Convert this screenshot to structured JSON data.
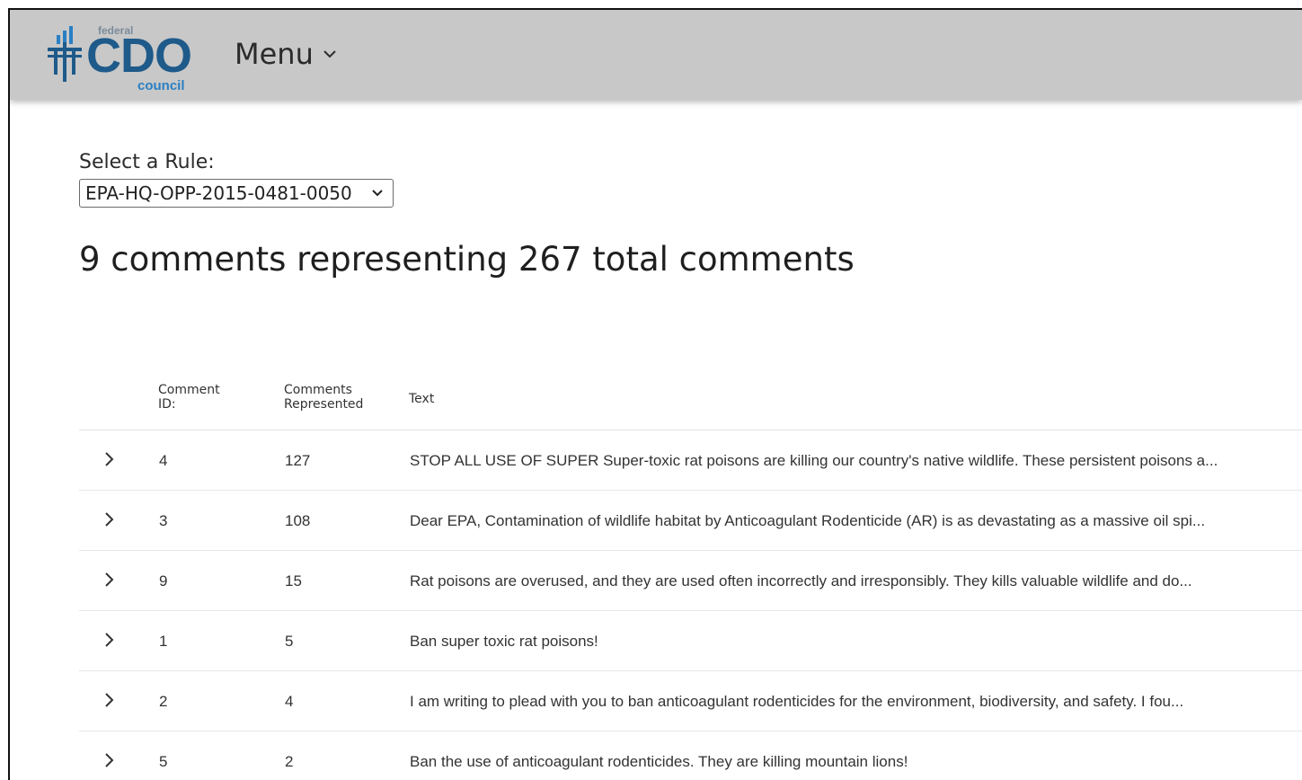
{
  "header": {
    "logo": {
      "federal": "federal",
      "cdo": "CDO",
      "council": "council",
      "brand_color": "#1e5a8a",
      "accent_color": "#2a7fc4"
    },
    "menu_label": "Menu"
  },
  "rule": {
    "label": "Select a Rule:",
    "selected": "EPA-HQ-OPP-2015-0481-0050"
  },
  "summary": "9 comments representing 267 total comments",
  "table": {
    "headers": {
      "id_line1": "Comment",
      "id_line2": "ID:",
      "rep_line1": "Comments",
      "rep_line2": "Represented",
      "text": "Text"
    },
    "rows": [
      {
        "id": "4",
        "represented": "127",
        "text": "STOP ALL USE OF SUPER Super-toxic rat poisons are killing our country's native wildlife. These persistent poisons a..."
      },
      {
        "id": "3",
        "represented": "108",
        "text": "Dear EPA, Contamination of wildlife habitat by Anticoagulant Rodenticide (AR) is as devastating as a massive oil spi..."
      },
      {
        "id": "9",
        "represented": "15",
        "text": "Rat poisons are overused, and they are used often incorrectly and irresponsibly. They kills valuable wildlife and do..."
      },
      {
        "id": "1",
        "represented": "5",
        "text": "Ban super toxic rat poisons!"
      },
      {
        "id": "2",
        "represented": "4",
        "text": "I am writing to plead with you to ban anticoagulant rodenticides for the environment, biodiversity, and safety. I fou..."
      },
      {
        "id": "5",
        "represented": "2",
        "text": "Ban the use of anticoagulant rodenticides. They are killing mountain lions!"
      }
    ]
  },
  "icons": {
    "logo": "federal-columns-icon",
    "menu": "chevron-down-icon",
    "select": "chevron-down-icon",
    "row_expand": "chevron-right-icon"
  }
}
